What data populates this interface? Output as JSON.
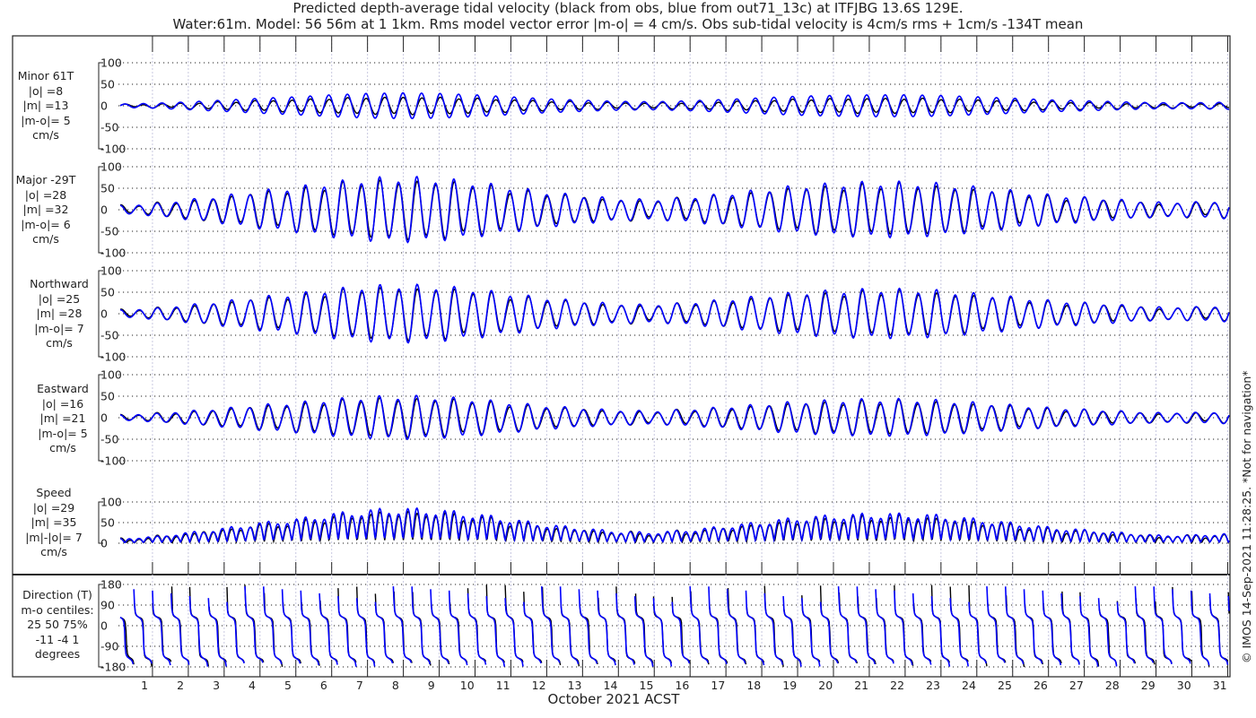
{
  "title": {
    "line1": "Predicted depth-average tidal velocity (black from obs, blue from out71_13c) at ITFJBG 13.6S 129E.",
    "line2": "Water:61m. Model: 56 56m at 1 1km. Rms model vector error |m-o| = 4 cm/s. Obs sub-tidal velocity is 4cm/s rms + 1cm/s -134T mean"
  },
  "copyright": "© IMOS 14-Sep-2021 11:28:25. *Not for navigation*",
  "colors": {
    "obs": "#000000",
    "model": "#0000ff",
    "grid": "#000000",
    "vgrid": "#c8c8e0"
  },
  "chart_data": {
    "type": "line",
    "xlabel": "October 2021 ACST",
    "x_ticks": [
      "1",
      "2",
      "3",
      "4",
      "5",
      "6",
      "7",
      "8",
      "9",
      "10",
      "11",
      "12",
      "13",
      "14",
      "15",
      "16",
      "17",
      "18",
      "19",
      "20",
      "21",
      "22",
      "23",
      "24",
      "25",
      "26",
      "27",
      "28",
      "29",
      "30",
      "31"
    ],
    "xlim_days": [
      0,
      31.1
    ],
    "tidal_period_days": 0.5175,
    "major_envelope_obs_cm_s": [
      8,
      12,
      20,
      28,
      38,
      45,
      55,
      62,
      65,
      62,
      55,
      45,
      35,
      28,
      22,
      20,
      25,
      32,
      40,
      48,
      52,
      55,
      55,
      52,
      45,
      38,
      30,
      25,
      20,
      15,
      15,
      18
    ],
    "model_to_obs_ratio": 1.1,
    "series_names": [
      "obs",
      "model"
    ],
    "panels": [
      {
        "id": "minor",
        "label": [
          "Minor 61T",
          "|o| =8",
          "|m| =13",
          "|m-o|= 5",
          "cm/s"
        ],
        "ylim": [
          -100,
          100
        ],
        "yticks": [
          "100",
          "50",
          "0",
          "-50",
          "-100"
        ]
      },
      {
        "id": "major",
        "label": [
          "Major -29T",
          "|o| =28",
          "|m| =32",
          "|m-o|= 6",
          "cm/s"
        ],
        "ylim": [
          -100,
          100
        ],
        "yticks": [
          "100",
          "50",
          "0",
          "-50",
          "-100"
        ]
      },
      {
        "id": "north",
        "label": [
          "Northward",
          "|o| =25",
          "|m| =28",
          "|m-o|= 7",
          "cm/s"
        ],
        "ylim": [
          -100,
          100
        ],
        "yticks": [
          "100",
          "50",
          "0",
          "-50",
          "-100"
        ]
      },
      {
        "id": "east",
        "label": [
          "Eastward",
          "|o| =16",
          "|m| =21",
          "|m-o|= 5",
          "cm/s"
        ],
        "ylim": [
          -100,
          100
        ],
        "yticks": [
          "100",
          "50",
          "0",
          "-50",
          "-100"
        ]
      },
      {
        "id": "speed",
        "label": [
          "Speed",
          "|o| =29",
          "|m| =35",
          "|m|-|o|= 7",
          "cm/s"
        ],
        "ylim": [
          0,
          100
        ],
        "yticks": [
          "100",
          "50",
          "0"
        ]
      },
      {
        "id": "dir",
        "label": [
          "Direction (T)",
          "m-o centiles:",
          "25  50  75%",
          "-11  -4   1",
          "degrees"
        ],
        "ylim": [
          -180,
          180
        ],
        "yticks": [
          "180",
          "90",
          "0",
          "-90",
          "-180"
        ]
      }
    ]
  }
}
